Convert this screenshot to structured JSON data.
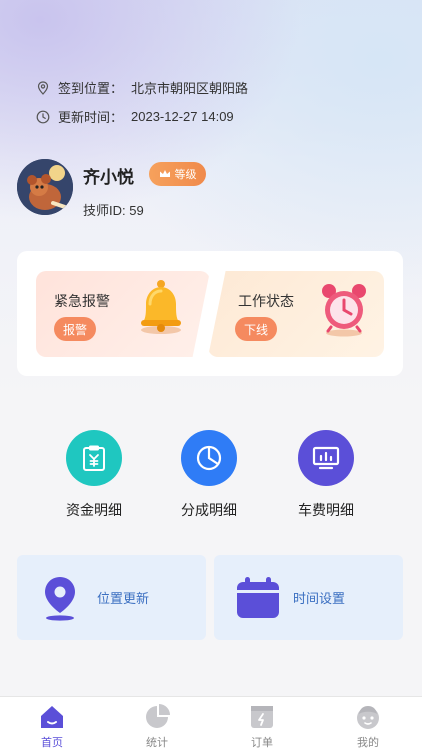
{
  "location": {
    "label": "签到位置：",
    "value": "北京市朝阳区朝阳路"
  },
  "update_time": {
    "label": "更新时间：",
    "value": "2023-12-27 14:09"
  },
  "user": {
    "name": "齐小悦",
    "badge": "等级",
    "tech_id": "技师ID: 59"
  },
  "actions": {
    "alarm": {
      "title": "紧急报警",
      "button": "报警"
    },
    "status": {
      "title": "工作状态",
      "button": "下线"
    }
  },
  "grid": [
    {
      "label": "资金明细",
      "icon": "clipboard-yen-icon",
      "color": "#1fc7c0"
    },
    {
      "label": "分成明细",
      "icon": "pie-chart-icon",
      "color": "#2f7cf6"
    },
    {
      "label": "车费明细",
      "icon": "monitor-chart-icon",
      "color": "#5b4fd8"
    }
  ],
  "features": [
    {
      "label": "位置更新",
      "icon": "location-pin-icon"
    },
    {
      "label": "时间设置",
      "icon": "calendar-icon"
    }
  ],
  "tabs": [
    {
      "label": "首页",
      "icon": "home-icon",
      "active": true
    },
    {
      "label": "统计",
      "icon": "pie-chart-icon"
    },
    {
      "label": "订单",
      "icon": "order-icon"
    },
    {
      "label": "我的",
      "icon": "profile-icon"
    }
  ],
  "colors": {
    "accent": "#5b4fd8",
    "orange": "#f58a5f"
  }
}
